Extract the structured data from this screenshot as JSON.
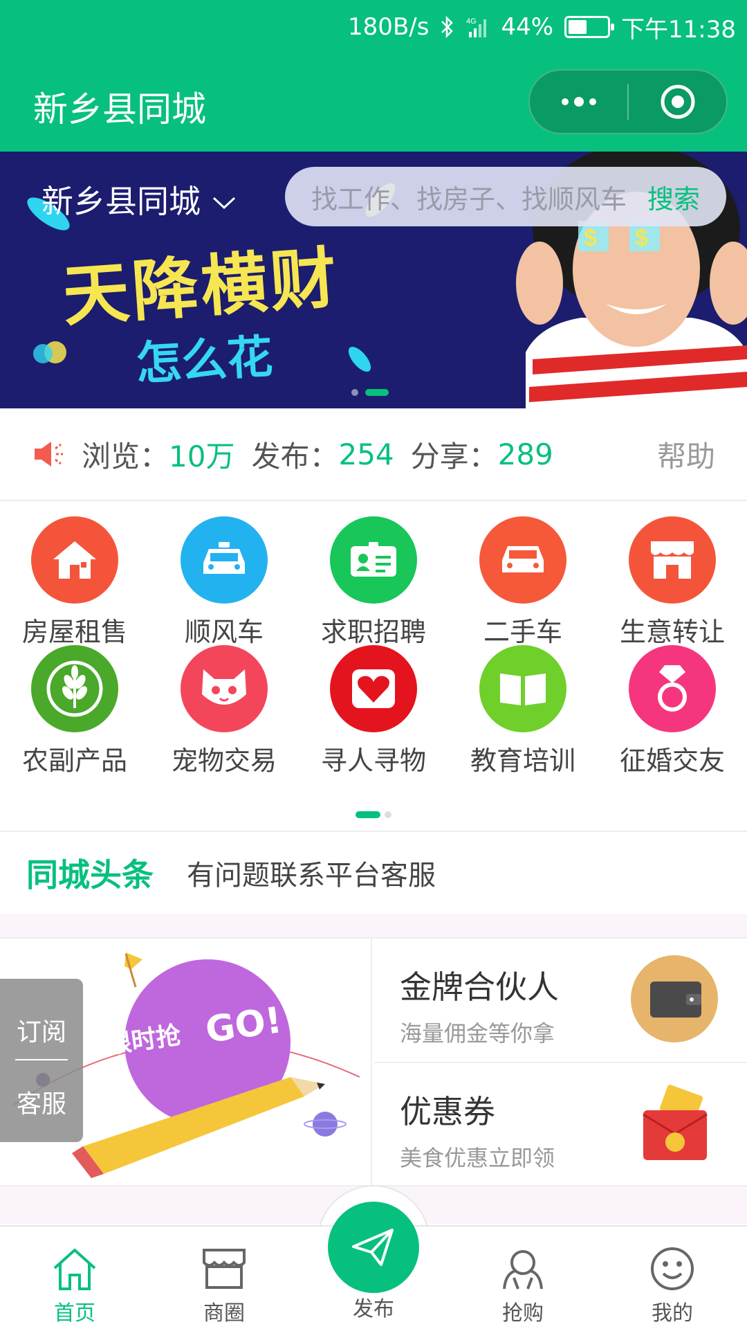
{
  "status_bar": {
    "speed": "180B/s",
    "signal": "4G",
    "battery": "44%",
    "time": "下午11:38"
  },
  "header": {
    "title": "新乡县同城",
    "menu_icon": "more-dots-icon",
    "close_icon": "target-circle-icon"
  },
  "banner": {
    "city": "新乡县同城",
    "search_placeholder": "找工作、找房子、找顺风车",
    "search_button": "搜索",
    "headline": "天降横财",
    "subline": "怎么花",
    "slide_count": 2,
    "active_slide": 2
  },
  "stats": {
    "views_label": "浏览：",
    "views_value": "10万",
    "posts_label": "发布：",
    "posts_value": "254",
    "shares_label": "分享：",
    "shares_value": "289",
    "help": "帮助"
  },
  "categories": [
    {
      "label": "房屋租售",
      "icon": "house-icon",
      "color": "#f4553a"
    },
    {
      "label": "顺风车",
      "icon": "taxi-icon",
      "color": "#22b2f0"
    },
    {
      "label": "求职招聘",
      "icon": "id-card-icon",
      "color": "#18c659"
    },
    {
      "label": "二手车",
      "icon": "car-icon",
      "color": "#f6583a"
    },
    {
      "label": "生意转让",
      "icon": "shop-icon",
      "color": "#f4553a"
    },
    {
      "label": "农副产品",
      "icon": "wheat-icon",
      "color": "#4aa82a"
    },
    {
      "label": "宠物交易",
      "icon": "cat-icon",
      "color": "#f3465a"
    },
    {
      "label": "寻人寻物",
      "icon": "heart-icon",
      "color": "#e4141e"
    },
    {
      "label": "教育培训",
      "icon": "book-icon",
      "color": "#6fcf2b"
    },
    {
      "label": "征婚交友",
      "icon": "diamond-ring-icon",
      "color": "#f5367e"
    }
  ],
  "news": {
    "tag": "同城头条",
    "text": "有问题联系平台客服"
  },
  "promo": {
    "left_title": "限时抢",
    "left_go": "GO!",
    "items": [
      {
        "title": "金牌合伙人",
        "subtitle": "海量佣金等你拿",
        "icon": "wallet-icon"
      },
      {
        "title": "优惠券",
        "subtitle": "美食优惠立即领",
        "icon": "coupon-icon"
      }
    ]
  },
  "side_float": {
    "subscribe": "订阅",
    "service": "客服"
  },
  "tabbar": [
    {
      "label": "首页",
      "icon": "home-icon",
      "active": true
    },
    {
      "label": "商圈",
      "icon": "store-icon",
      "active": false
    },
    {
      "label": "发布",
      "icon": "paper-plane-icon",
      "active": false
    },
    {
      "label": "抢购",
      "icon": "grab-icon",
      "active": false
    },
    {
      "label": "我的",
      "icon": "smiley-icon",
      "active": false
    }
  ],
  "colors": {
    "brand": "#07c07e",
    "banner_bg": "#1c1d6e"
  }
}
